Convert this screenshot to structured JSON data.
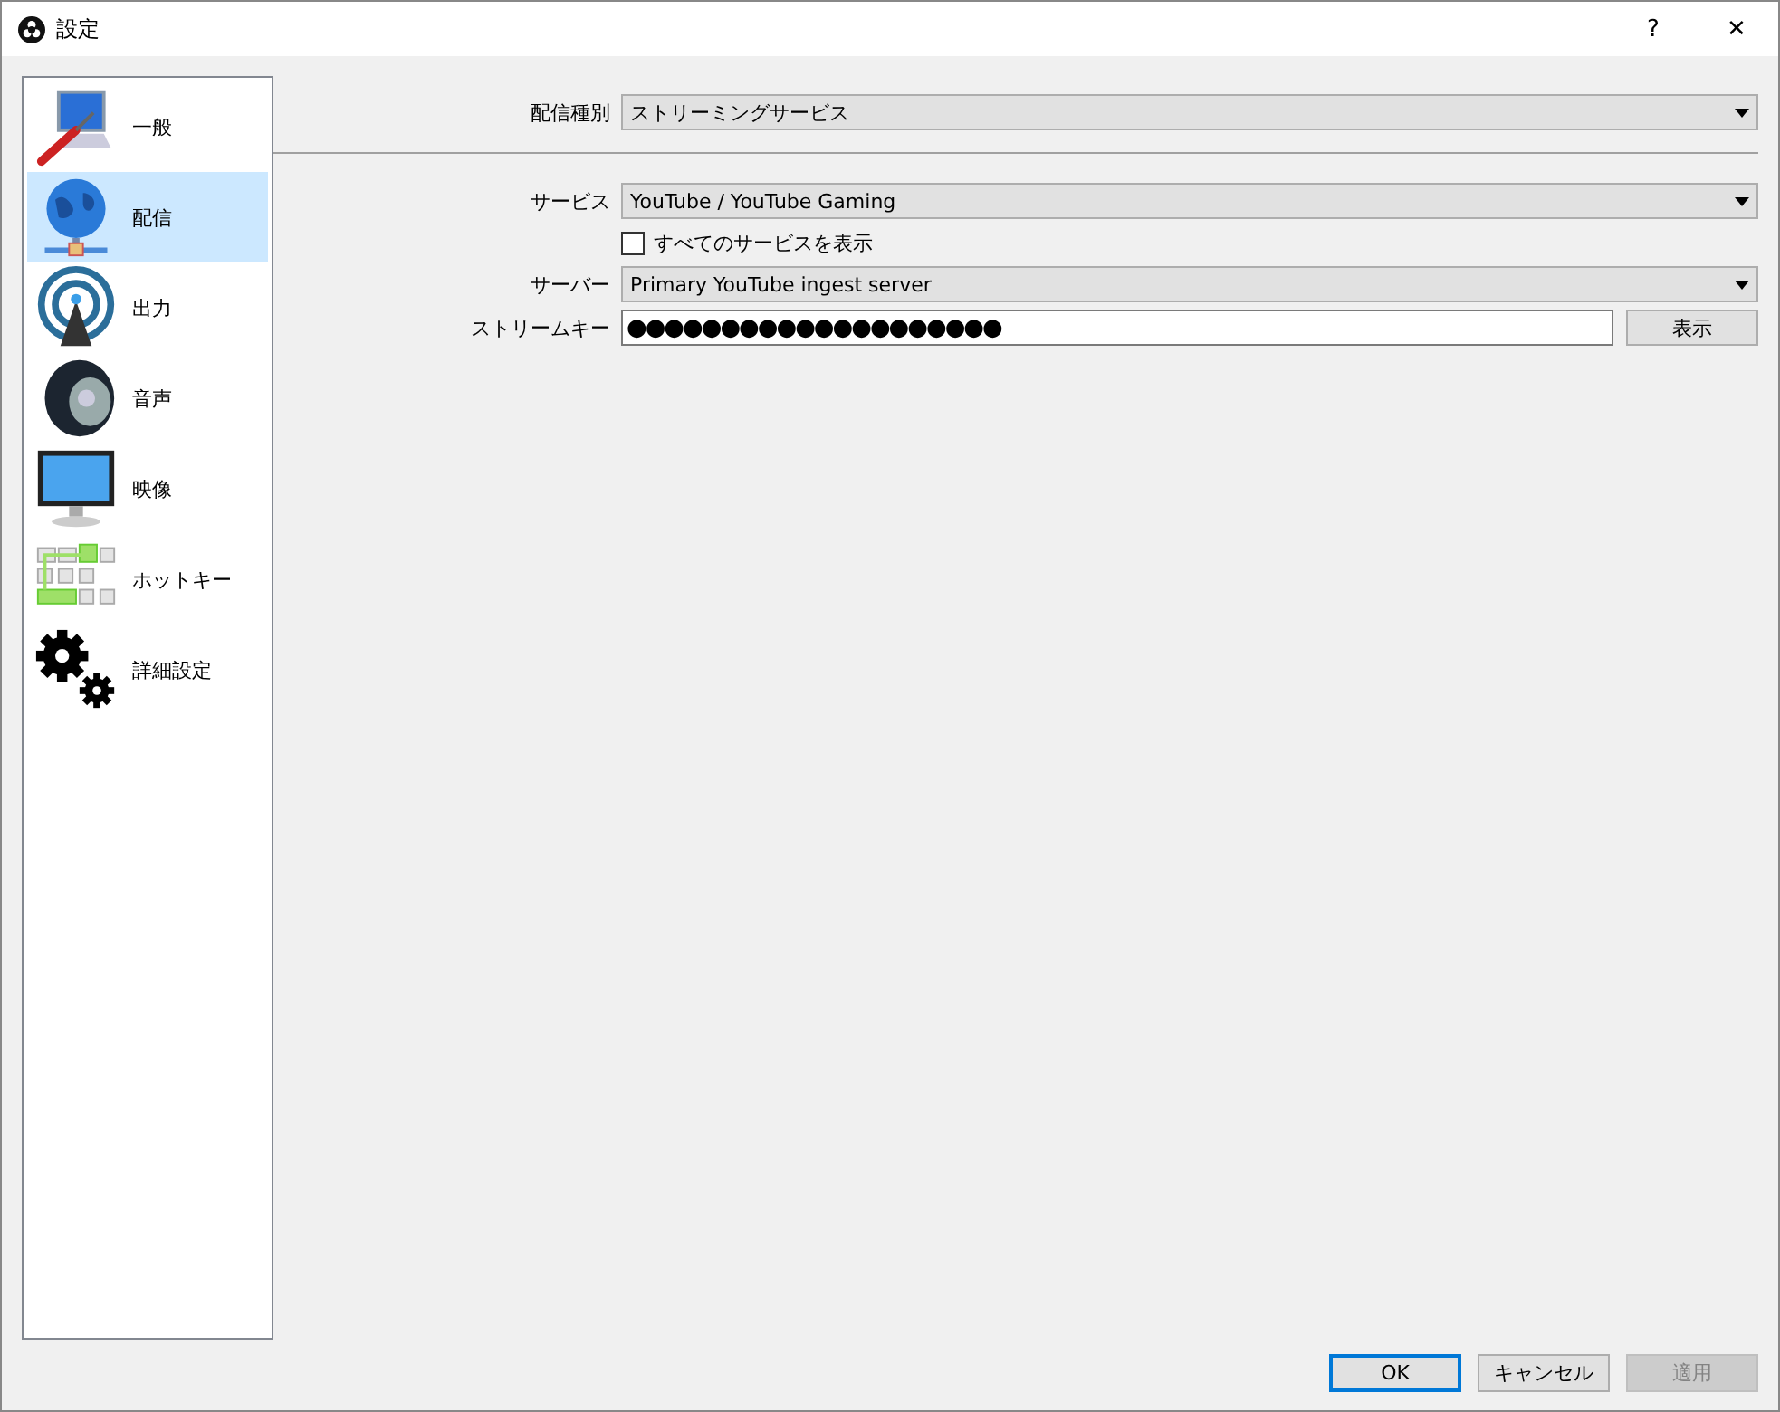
{
  "window": {
    "title": "設定",
    "help": "?",
    "close": "✕"
  },
  "sidebar": {
    "items": [
      {
        "label": "一般",
        "selected": false
      },
      {
        "label": "配信",
        "selected": true
      },
      {
        "label": "出力",
        "selected": false
      },
      {
        "label": "音声",
        "selected": false
      },
      {
        "label": "映像",
        "selected": false
      },
      {
        "label": "ホットキー",
        "selected": false
      },
      {
        "label": "詳細設定",
        "selected": false
      }
    ]
  },
  "stream_type": {
    "label": "配信種別",
    "value": "ストリーミングサービス"
  },
  "service": {
    "label": "サービス",
    "value": "YouTube / YouTube Gaming"
  },
  "show_all": {
    "label": "すべてのサービスを表示",
    "checked": false
  },
  "server": {
    "label": "サーバー",
    "value": "Primary YouTube ingest server"
  },
  "stream_key": {
    "label": "ストリームキー",
    "value": "●●●●●●●●●●●●●●●●●●●●",
    "button": "表示"
  },
  "buttons": [
    {
      "label": "OK",
      "kind": "default",
      "disabled": false
    },
    {
      "label": "キャンセル",
      "kind": "normal",
      "disabled": false
    },
    {
      "label": "適用",
      "kind": "normal",
      "disabled": true
    }
  ]
}
